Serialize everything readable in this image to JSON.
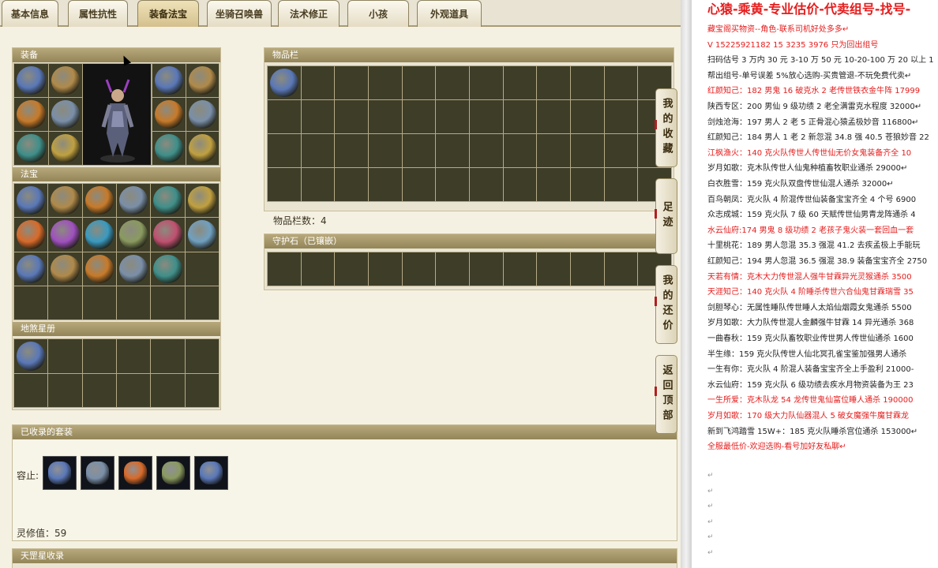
{
  "tabs": [
    "基本信息",
    "属性抗性",
    "装备法宝",
    "坐骑召唤兽",
    "法术修正",
    "小孩",
    "外观道具"
  ],
  "active_tab": 2,
  "panels": {
    "equip": "装备",
    "fabao": "法宝",
    "dihun": "地煞星册",
    "inventory": "物品栏",
    "inventory_count": "物品栏数：4",
    "guardian": "守护石（已镶嵌）",
    "collected": "已收录的套装",
    "rongzhi_label": "容止:",
    "lingyun": "灵修值：59",
    "tiangang": "天罡星收录"
  },
  "side_buttons": [
    "我的收藏",
    "足迹",
    "我的还价",
    "返回顶部"
  ],
  "doc": {
    "title": "心猿-乘黄-专业估价-代卖组号-找号-",
    "lines": [
      {
        "t": "藏宝阁买物资--角色-联系司机好处多多↵",
        "c": "red"
      },
      {
        "t": "V 15225921182  15 3235 3976 只为回出组号",
        "c": "red"
      },
      {
        "t": "扫码估号 3 万内 30 元 3-10 万 50 元 10-20-100 万 20 以上 1",
        "c": "blk"
      },
      {
        "t": "帮出组号-单号误差 5%放心选购-买贵管退-不玩免费代卖↵",
        "c": "blk"
      },
      {
        "t": "红颜知己：182 男鬼 16 破克水 2 老传世铁衣金牛阵 17999",
        "c": "red"
      },
      {
        "t": "陕西专区：200 男仙 9 级功绩 2 老全满雷克水程度 32000↵",
        "c": "blk"
      },
      {
        "t": "剑烛沧海：197 男人 2 老 5 正骨混心猿孟极妙音 116800↵",
        "c": "blk"
      },
      {
        "t": "红颜知己：184 男人 1 老 2 新忽混 34.8 强 40.5 苍狼妙音 22",
        "c": "blk"
      },
      {
        "t": "江枫渔火：140 克火队传世人传世仙无价女鬼装备齐全 10",
        "c": "red"
      },
      {
        "t": "岁月如歌：克木队传世人仙鬼种植畜牧职业通杀 29000↵",
        "c": "blk"
      },
      {
        "t": "白衣胜雪：159 克火队双盘传世仙混人通杀 32000↵",
        "c": "blk"
      },
      {
        "t": "百鸟朝凤：克火队 4 阶混传世仙装备宝宝齐全 4 个号 6900",
        "c": "blk"
      },
      {
        "t": "众志成城：159 克火队 7 级 60 天赋传世仙男青龙阵通杀 4",
        "c": "blk"
      },
      {
        "t": "水云仙府:174 男鬼 8 级功绩 2 老孩子鬼火装一套回血一套",
        "c": "red"
      },
      {
        "t": "十里桃花：189 男人忽混 35.3 强混 41.2 去疾孟极上手能玩",
        "c": "blk"
      },
      {
        "t": "红颜知己：194 男人忽混 36.5 强混 38.9 装备宝宝齐全 2750",
        "c": "blk"
      },
      {
        "t": "天若有情：克木大力传世混人强牛甘霖异光灵猴通杀 3500",
        "c": "red"
      },
      {
        "t": "天涯知己：140 克火队 4 阶睡杀传世六合仙鬼甘霖瑞雪 35",
        "c": "red"
      },
      {
        "t": "剑胆琴心：无属性睡队传世睡人太焰仙烟霞女鬼通杀 5500",
        "c": "blk"
      },
      {
        "t": "岁月如歌：大力队传世混人金麟强牛甘霖 14 异光通杀 368",
        "c": "blk"
      },
      {
        "t": "一曲春秋：159 克火队畜牧职业传世男人传世仙通杀 1600",
        "c": "blk"
      },
      {
        "t": "半生缘：159 克火队传世人仙北冥孔雀宝鉴加强男人通杀",
        "c": "blk"
      },
      {
        "t": "一生有你：克火队 4 阶混人装备宝宝齐全上手盈利 21000-",
        "c": "blk"
      },
      {
        "t": "水云仙府：159 克火队 6 级功绩去疾水月物资装备为王 23",
        "c": "blk"
      },
      {
        "t": "一生所爱：克木队龙 54 龙传世鬼仙富位睡人通杀 190000",
        "c": "red"
      },
      {
        "t": "岁月如歌：170 级大力队仙器混人 5 破女魔强牛魔甘霖龙",
        "c": "red"
      },
      {
        "t": "新到飞鸿踏雪 15W+：185 克火队睡杀宫位通杀 153000↵",
        "c": "blk"
      },
      {
        "t": "全服最低价-欢迎选购-看号加好友私聊↵",
        "c": "red"
      }
    ],
    "return_mark": "↵"
  },
  "colors": {
    "tab_active": "#d4c08e",
    "panel_head": "#938558",
    "cell": "#3e3d28",
    "red_text": "#e51c1c"
  },
  "icons": {
    "equip": [
      "helmet-icon",
      "boots-icon",
      "ring-icon",
      "bracelet-icon",
      "spear-icon",
      "armor-icon",
      "crown-icon",
      "belt-icon",
      "necklace-icon",
      "shoe-icon",
      "jade-icon",
      "orb-icon"
    ],
    "fabao": [
      "flame-icon",
      "cage-icon",
      "tile-icon",
      "plant-icon",
      "lantern-icon",
      "flower-icon",
      "sword-icon",
      "vortex-icon",
      "book-icon",
      "ring-icon",
      "claw-icon",
      "pagoda-icon",
      "cannon-icon",
      "bag-icon",
      "scroll-icon",
      "hook-icon",
      "bell-icon"
    ],
    "suit": [
      "cloak-icon",
      "dagger-icon",
      "bowl-icon",
      "gauntlet-icon",
      "mask-icon"
    ]
  }
}
